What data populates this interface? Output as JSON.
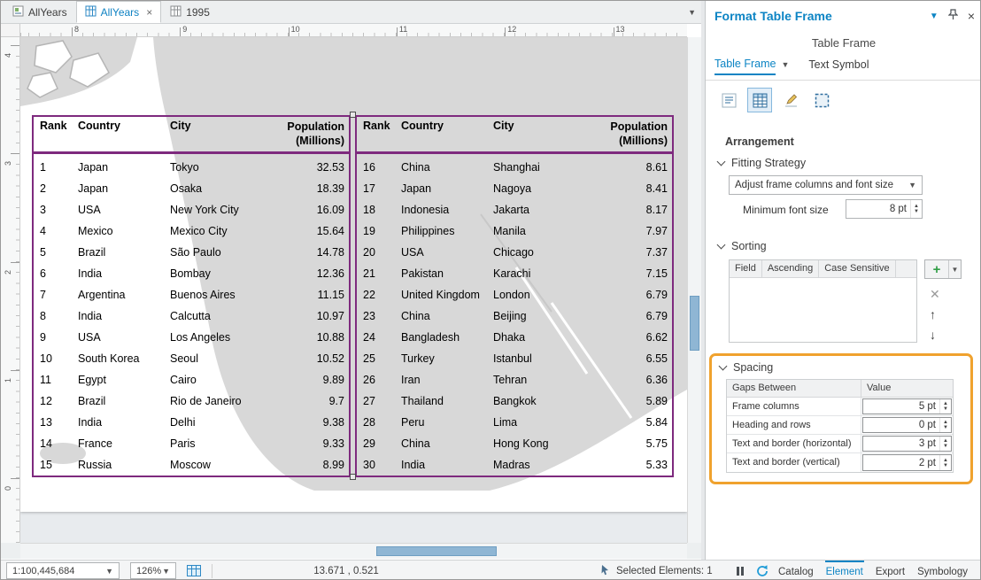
{
  "doc_tabs": {
    "tabs": [
      {
        "label": "AllYears"
      },
      {
        "label": "AllYears"
      },
      {
        "label": "1995"
      }
    ]
  },
  "rulers": {
    "h": [
      "8",
      "9",
      "10",
      "11",
      "12",
      "13"
    ],
    "v": [
      "4",
      "3",
      "2",
      "1",
      "0"
    ]
  },
  "table_frame": {
    "columns": [
      "Rank",
      "Country",
      "City",
      "Population (Millions)"
    ],
    "left_rows": [
      [
        "1",
        "Japan",
        "Tokyo",
        "32.53"
      ],
      [
        "2",
        "Japan",
        "Osaka",
        "18.39"
      ],
      [
        "3",
        "USA",
        "New York City",
        "16.09"
      ],
      [
        "4",
        "Mexico",
        "Mexico City",
        "15.64"
      ],
      [
        "5",
        "Brazil",
        "São Paulo",
        "14.78"
      ],
      [
        "6",
        "India",
        "Bombay",
        "12.36"
      ],
      [
        "7",
        "Argentina",
        "Buenos Aires",
        "11.15"
      ],
      [
        "8",
        "India",
        "Calcutta",
        "10.97"
      ],
      [
        "9",
        "USA",
        "Los Angeles",
        "10.88"
      ],
      [
        "10",
        "South Korea",
        "Seoul",
        "10.52"
      ],
      [
        "11",
        "Egypt",
        "Cairo",
        "9.89"
      ],
      [
        "12",
        "Brazil",
        "Rio de Janeiro",
        "9.7"
      ],
      [
        "13",
        "India",
        "Delhi",
        "9.38"
      ],
      [
        "14",
        "France",
        "Paris",
        "9.33"
      ],
      [
        "15",
        "Russia",
        "Moscow",
        "8.99"
      ]
    ],
    "right_rows": [
      [
        "16",
        "China",
        "Shanghai",
        "8.61"
      ],
      [
        "17",
        "Japan",
        "Nagoya",
        "8.41"
      ],
      [
        "18",
        "Indonesia",
        "Jakarta",
        "8.17"
      ],
      [
        "19",
        "Philippines",
        "Manila",
        "7.97"
      ],
      [
        "20",
        "USA",
        "Chicago",
        "7.37"
      ],
      [
        "21",
        "Pakistan",
        "Karachi",
        "7.15"
      ],
      [
        "22",
        "United Kingdom",
        "London",
        "6.79"
      ],
      [
        "23",
        "China",
        "Beijing",
        "6.79"
      ],
      [
        "24",
        "Bangladesh",
        "Dhaka",
        "6.62"
      ],
      [
        "25",
        "Turkey",
        "Istanbul",
        "6.55"
      ],
      [
        "26",
        "Iran",
        "Tehran",
        "6.36"
      ],
      [
        "27",
        "Thailand",
        "Bangkok",
        "5.89"
      ],
      [
        "28",
        "Peru",
        "Lima",
        "5.84"
      ],
      [
        "29",
        "China",
        "Hong Kong",
        "5.75"
      ],
      [
        "30",
        "India",
        "Madras",
        "5.33"
      ]
    ]
  },
  "panel": {
    "title": "Format Table Frame",
    "subtitle": "Table Frame",
    "tabs": {
      "primary": "Table Frame",
      "secondary": "Text Symbol"
    },
    "arrangement": {
      "heading": "Arrangement",
      "fitting_strategy": {
        "label": "Fitting Strategy",
        "value": "Adjust frame columns and font size",
        "min_font_label": "Minimum font size",
        "min_font_value": "8 pt"
      },
      "sorting": {
        "label": "Sorting",
        "columns": [
          "Field",
          "Ascending",
          "Case Sensitive"
        ]
      },
      "spacing": {
        "label": "Spacing",
        "columns": [
          "Gaps Between",
          "Value"
        ],
        "rows": [
          {
            "label": "Frame columns",
            "value": "5 pt"
          },
          {
            "label": "Heading and rows",
            "value": "0 pt"
          },
          {
            "label": "Text and border (horizontal)",
            "value": "3 pt"
          },
          {
            "label": "Text and border (vertical)",
            "value": "2 pt"
          }
        ]
      }
    },
    "footer_tabs": [
      {
        "label": "Catalog"
      },
      {
        "label": "Element"
      },
      {
        "label": "Export"
      },
      {
        "label": "Symbology"
      }
    ]
  },
  "statusbar": {
    "scale": "1:100,445,684",
    "zoom": "126%",
    "coordinates": "13.671 , 0.521",
    "selected": "Selected Elements: 1"
  },
  "icons": {
    "panel_tab_icons": [
      "text-options-icon",
      "table-grid-icon",
      "pencil-icon",
      "frame-border-icon"
    ],
    "sort_tools": [
      "add-plus-icon",
      "remove-icon",
      "move-up-icon",
      "move-down-icon"
    ]
  },
  "colors": {
    "accent": "#0c84c4",
    "table_border": "#7e2a7e",
    "highlight": "#f0a22e"
  }
}
